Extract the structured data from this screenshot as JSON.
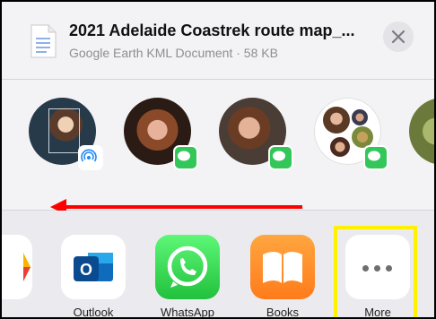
{
  "header": {
    "title": "2021 Adelaide Coastrek route map_...",
    "subtitle": "Google Earth KML Document · 58 KB",
    "doc_icon": "document-icon",
    "close_icon": "close-icon"
  },
  "people": [
    {
      "name_icon": "contact-avatar",
      "badge": "airdrop-icon"
    },
    {
      "name_icon": "contact-avatar",
      "badge": "messages-icon"
    },
    {
      "name_icon": "contact-avatar",
      "badge": "messages-icon"
    },
    {
      "name_icon": "group-avatar",
      "badge": "messages-icon"
    },
    {
      "name_icon": "contact-avatar",
      "badge": ""
    }
  ],
  "annotation": {
    "arrow_color": "#ff0000",
    "highlight_color": "#fff200"
  },
  "apps": [
    {
      "label": "Outlook",
      "icon": "outlook-icon"
    },
    {
      "label": "WhatsApp",
      "icon": "whatsapp-icon"
    },
    {
      "label": "Books",
      "icon": "books-icon"
    },
    {
      "label": "More",
      "icon": "more-icon"
    }
  ]
}
